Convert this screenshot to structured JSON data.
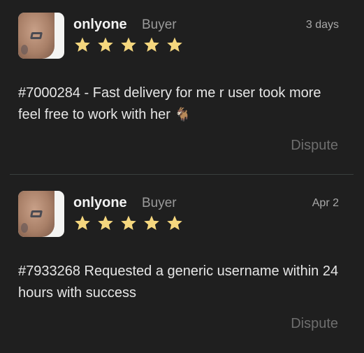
{
  "reviews": [
    {
      "name": "onlyone",
      "role": "Buyer",
      "date": "3 days",
      "rating": 5,
      "text": "#7000284 - Fast delivery for me r user took more feel free to work with her",
      "emoji": "🐐",
      "action": "Dispute"
    },
    {
      "name": "onlyone",
      "role": "Buyer",
      "date": "Apr 2",
      "rating": 5,
      "text": "#7933268 Requested a generic username within 24 hours with success",
      "emoji": "",
      "action": "Dispute"
    }
  ],
  "colors": {
    "background": "#1f1f1f",
    "star": "#f5d77e",
    "name": "#f2f2f2",
    "muted": "#9a9a9a",
    "dispute": "#6e6e6e"
  }
}
